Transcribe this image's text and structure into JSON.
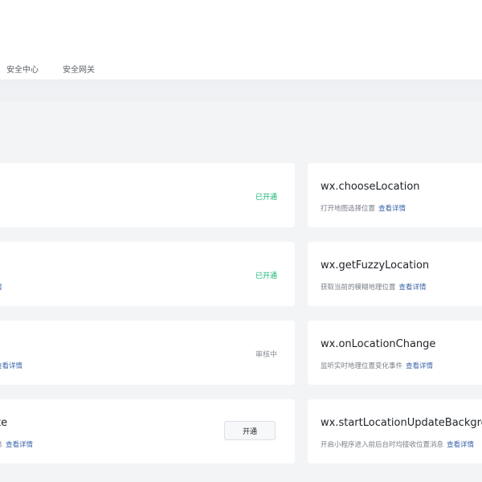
{
  "nav": {
    "tabs": [
      {
        "label": "安全中心"
      },
      {
        "label": "安全网关"
      }
    ]
  },
  "left_cards": [
    {
      "name": "",
      "desc": "",
      "link": "",
      "status": "已开通",
      "status_type": "on"
    },
    {
      "name": "",
      "desc": "",
      "link": "情",
      "status": "已开通",
      "status_type": "on"
    },
    {
      "name": "",
      "desc": "",
      "link": "查看详情",
      "status": "审核中",
      "status_type": "review"
    },
    {
      "name": "ate",
      "desc": "消息",
      "link": "查看详情",
      "button": "开通"
    }
  ],
  "right_cards": [
    {
      "name": "wx.chooseLocation",
      "desc": "打开地图选择位置",
      "link": "查看详情"
    },
    {
      "name": "wx.getFuzzyLocation",
      "desc": "获取当前的模糊地理位置",
      "link": "查看详情"
    },
    {
      "name": "wx.onLocationChange",
      "desc": "监听实时地理位置变化事件",
      "link": "查看详情"
    },
    {
      "name": "wx.startLocationUpdateBackgro",
      "desc": "开启小程序进入前后台时均接收位置消息",
      "link": "查看详情"
    }
  ]
}
